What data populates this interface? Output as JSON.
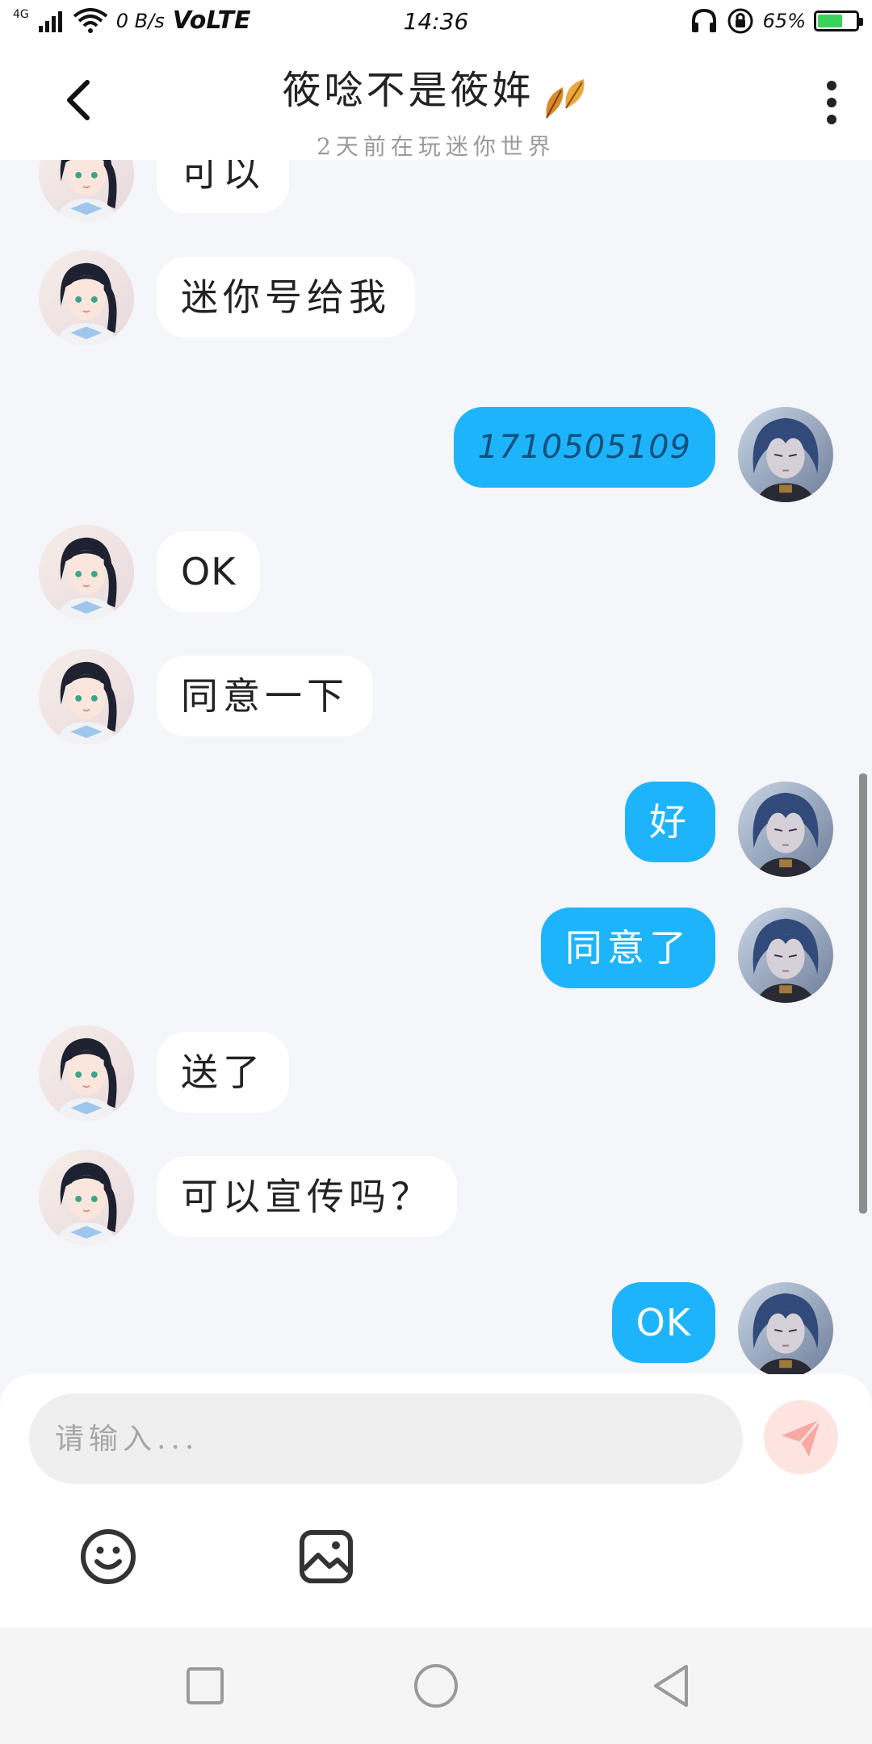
{
  "status_bar": {
    "network": "4G",
    "speed": "0 B/s",
    "volte": "VoLTE",
    "time": "14:36",
    "battery_percent": "65%",
    "battery_level": 0.65,
    "battery_color": "#3ad35a"
  },
  "header": {
    "title": "筱唸不是筱姩",
    "subtitle": "2天前在玩迷你世界"
  },
  "messages": [
    {
      "side": "left",
      "text": "可以"
    },
    {
      "side": "left",
      "text": "迷你号给我"
    },
    {
      "side": "right",
      "text": "1710505109"
    },
    {
      "side": "left",
      "text": "OK"
    },
    {
      "side": "left",
      "text": "同意一下"
    },
    {
      "side": "right",
      "text": "好"
    },
    {
      "side": "right",
      "text": "同意了"
    },
    {
      "side": "left",
      "text": "送了"
    },
    {
      "side": "left",
      "text": "可以宣传吗？"
    },
    {
      "side": "right",
      "text": "OK"
    }
  ],
  "composer": {
    "placeholder": "请输入...",
    "accent": "#1eb4fb"
  },
  "icons": {
    "back": "chevron-left-icon",
    "more": "more-vertical-icon",
    "send": "send-icon",
    "emoji": "emoji-icon",
    "image": "image-icon"
  }
}
